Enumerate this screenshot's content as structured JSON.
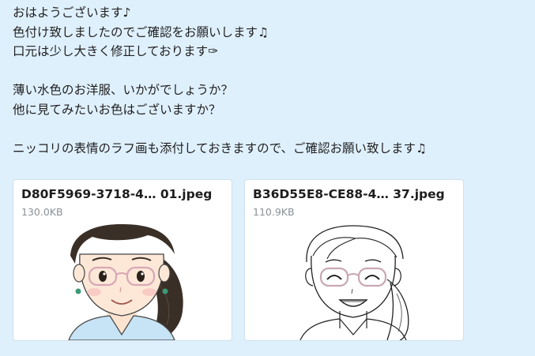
{
  "message": {
    "lines": [
      "おはようございます♪",
      "色付け致しましたのでご確認をお願いします♫",
      "口元は少し大きく修正しております✑",
      "",
      "薄い水色のお洋服、いかがでしょうか？",
      "他に見てみたいお色はございますか？",
      "",
      "ニッコリの表情のラフ画も添付しておきますので、ご確認お願い致します♫"
    ]
  },
  "attachments": [
    {
      "filename": "D80F5969-3718-4… 01.jpeg",
      "size": "130.0KB",
      "preview": "colored-illustration"
    },
    {
      "filename": "B36D55E8-CE88-4… 37.jpeg",
      "size": "110.9KB",
      "preview": "line-sketch"
    }
  ],
  "colors": {
    "background": "#dff0fd",
    "card": "#ffffff",
    "clothing": "#c7e4f6",
    "hair": "#3a2f27"
  }
}
